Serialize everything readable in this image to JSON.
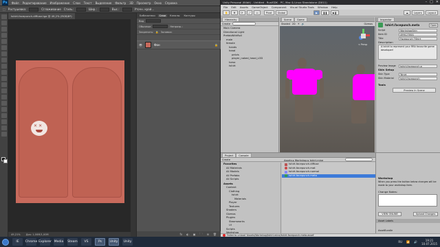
{
  "photoshop": {
    "logo": "Ps",
    "menu": [
      "Файл",
      "Редактирование",
      "Изображение",
      "Слои",
      "Текст",
      "Выделение",
      "Фильтр",
      "3D",
      "Просмотр",
      "Окно",
      "Справка"
    ],
    "options": {
      "feather_label": "Растушевка:",
      "feather_value": "0 пикс",
      "antialias": "Сглаживание",
      "style_label": "Стиль:",
      "style_value": "Обычный",
      "width_label": "Шир.:",
      "height_label": "Выс.:",
      "refine": "Уточн. край..."
    },
    "doc_tab": "tshirt.facepunch.diffuse.tga @ 49,2% (RGB/8*)",
    "status_zoom": "49,21%",
    "status_doc": "Док: 1,00M/1,00M",
    "panel_tabs": [
      "Библиотеки",
      "Слои",
      "Каналы",
      "Контуры"
    ],
    "panel_row_kind": "Вид",
    "panel_row_mode": "Обычные",
    "panel_row_opacity": "Непрозр.:",
    "panel_row_lock": "Закрепить:",
    "panel_row_fill": "Заливка:",
    "layer_name": "Фон",
    "panel_bottom": [
      "fx",
      "◐",
      "▣",
      "🗀",
      "⊞",
      "🗑"
    ]
  },
  "unity": {
    "title": "Unity Personal (64bit) - Untitled - RustSDK - PC, Mac & Linux Standalone (DX11)",
    "menu": [
      "File",
      "Edit",
      "Assets",
      "GameObject",
      "Component",
      "Visual Studio Tools",
      "Window",
      "Help"
    ],
    "toolbar": {
      "pivot": "Pivot",
      "global": "Global",
      "layers": "Layers",
      "layout": "Layout"
    },
    "hierarchy": {
      "tab": "Hierarchy",
      "create": "Create",
      "items": [
        "Main Camera",
        "Directional Light",
        "PrefabWithRoll",
        "male",
        "female",
        "hands",
        "head",
        "pelvis",
        "player_naked_head_LOD",
        "torso",
        "tshirt"
      ]
    },
    "scene": {
      "tab_scene": "Scene",
      "tab_game": "Game",
      "shaded": "Shaded",
      "mode_2d": "2D",
      "gizmos": "Gizmos",
      "persp": "< Persp"
    },
    "inspector": {
      "tab": "Inspector",
      "name": "tshirt.facepunch.meta",
      "open": "Open",
      "fields": [
        {
          "k": "Script",
          "v": "WorkshopSkin"
        },
        {
          "k": "Item ID",
          "v": "499127801"
        },
        {
          "k": "Title",
          "v": "Facepunch TShirt"
        }
      ],
      "description_label": "Description",
      "description_text": "A tshirt to represent your RRA favourite game developer!",
      "preview_label": "Preview Image",
      "preview_value": "tshirt.facepunch.p",
      "skin_setup": "Skin Setup",
      "skin_type_label": "Skin Type",
      "skin_type_value": "Tshirt",
      "skin_mat_label": "Skin Material",
      "skin_mat_value": "tshirt.facepunch",
      "tools_label": "Tools",
      "preview_button": "Preview In Scene"
    },
    "project": {
      "tab_project": "Project",
      "tab_console": "Console",
      "create": "Create",
      "favorites": [
        "Favorites",
        "All Materials",
        "All Models",
        "All Prefabs",
        "All Scripts"
      ],
      "tree": [
        "Assets",
        "Content",
        "Clothing",
        "tshirt",
        "Materials",
        "Player",
        "Textures",
        "Shaders",
        "Gizmos",
        "Plugins",
        "Steamworks",
        "UI",
        "Scripts",
        "Workshop",
        "tshirt.facepunch"
      ],
      "path": "Assets ▸ Workshop ▸ tshirt.mine",
      "files": [
        "tshirt.facepunch.diffuse",
        "tshirt.facepunch.mat",
        "tshirt.facepunch.normal",
        "tshirt.facepunch.meta"
      ],
      "bottom": "tshirt.facepunch.meta.asset"
    },
    "workshop": {
      "header": "Workshop",
      "desc": "When you press the button below changes will be made to your workshop item.",
      "notes_label": "Change Notes:",
      "view_button": "VIEW ONLINE",
      "upload_button": "Upload Changes",
      "asset_labels": "Asset Labels",
      "asset_bundle": "AssetBundle"
    },
    "status": "Failed to unload 'Assets/Workshop/tshirt.mine/tshirt.facepunch.meta.asset'"
  },
  "taskbar": {
    "apps": [
      "IE",
      "Chrome",
      "Explorer",
      "Media",
      "Steam",
      "VS",
      "Ps",
      "Unity",
      "Unity"
    ],
    "lang": "RU",
    "time": "19:21",
    "date": "10.07.2015"
  },
  "colors": {
    "ps_bg": "#424242",
    "texture": "#c86a5c",
    "tshirt_pink": "#ff00ff",
    "selection": "#3d7bd9"
  }
}
